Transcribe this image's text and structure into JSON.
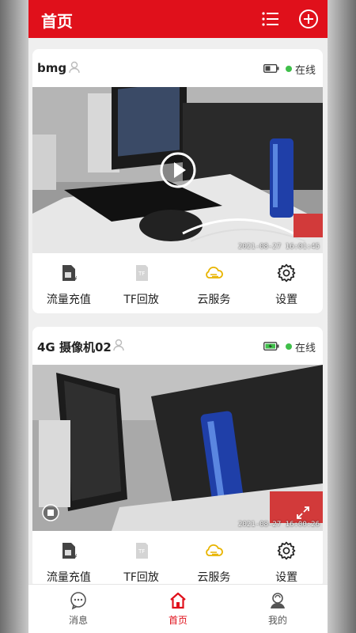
{
  "header": {
    "title": "首页",
    "icons": [
      "list-icon",
      "add-circle-icon"
    ]
  },
  "devices": [
    {
      "name": "bmg",
      "status": "在线",
      "battery_icon": "battery-low-icon",
      "timestamp": "2021-08-27 16:01:45",
      "actions": [
        {
          "label": "流量充值",
          "icon": "sim-card-icon"
        },
        {
          "label": "TF回放",
          "icon": "tf-card-icon"
        },
        {
          "label": "云服务",
          "icon": "cloud-icon"
        },
        {
          "label": "设置",
          "icon": "gear-icon"
        }
      ]
    },
    {
      "name": "4G 摄像机02",
      "status": "在线",
      "battery_icon": "battery-charging-icon",
      "timestamp": "2021-08-27 16:00:26",
      "actions": [
        {
          "label": "流量充值",
          "icon": "sim-card-icon"
        },
        {
          "label": "TF回放",
          "icon": "tf-card-icon"
        },
        {
          "label": "云服务",
          "icon": "cloud-icon"
        },
        {
          "label": "设置",
          "icon": "gear-icon"
        }
      ]
    }
  ],
  "nav": [
    {
      "label": "消息",
      "icon": "message-icon"
    },
    {
      "label": "首页",
      "icon": "home-icon",
      "active": true
    },
    {
      "label": "我的",
      "icon": "profile-icon"
    }
  ],
  "colors": {
    "brand": "#e0101b",
    "online": "#3fbf4a",
    "cloud": "#e8b400"
  }
}
